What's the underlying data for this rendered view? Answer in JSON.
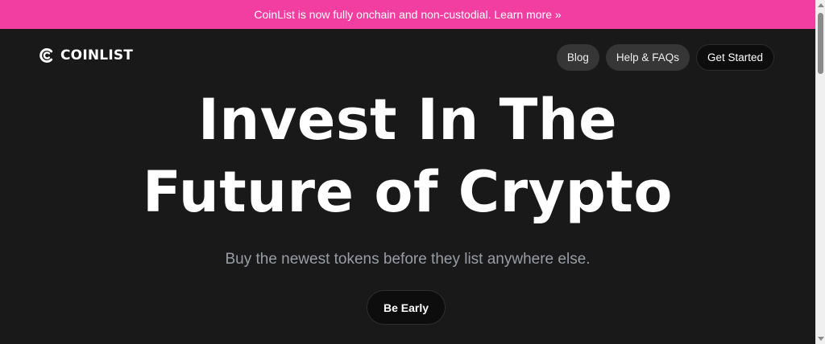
{
  "banner": {
    "text": "CoinList is now fully onchain and non-custodial. Learn more »",
    "color": "#f23ea0"
  },
  "header": {
    "logo_text": "COINLIST",
    "logo_icon": "coinlist-c-icon",
    "nav": {
      "blog_label": "Blog",
      "help_label": "Help & FAQs",
      "get_started_label": "Get Started"
    }
  },
  "hero": {
    "title_line1": "Invest In The",
    "title_line2": "Future of Crypto",
    "subtitle": "Buy the newest tokens before they list anywhere else.",
    "cta_label": "Be Early"
  },
  "colors": {
    "background": "#1a1919",
    "nav_button": "#363636",
    "primary_button": "#0d0d0d",
    "subtitle": "#9a9ca6"
  }
}
